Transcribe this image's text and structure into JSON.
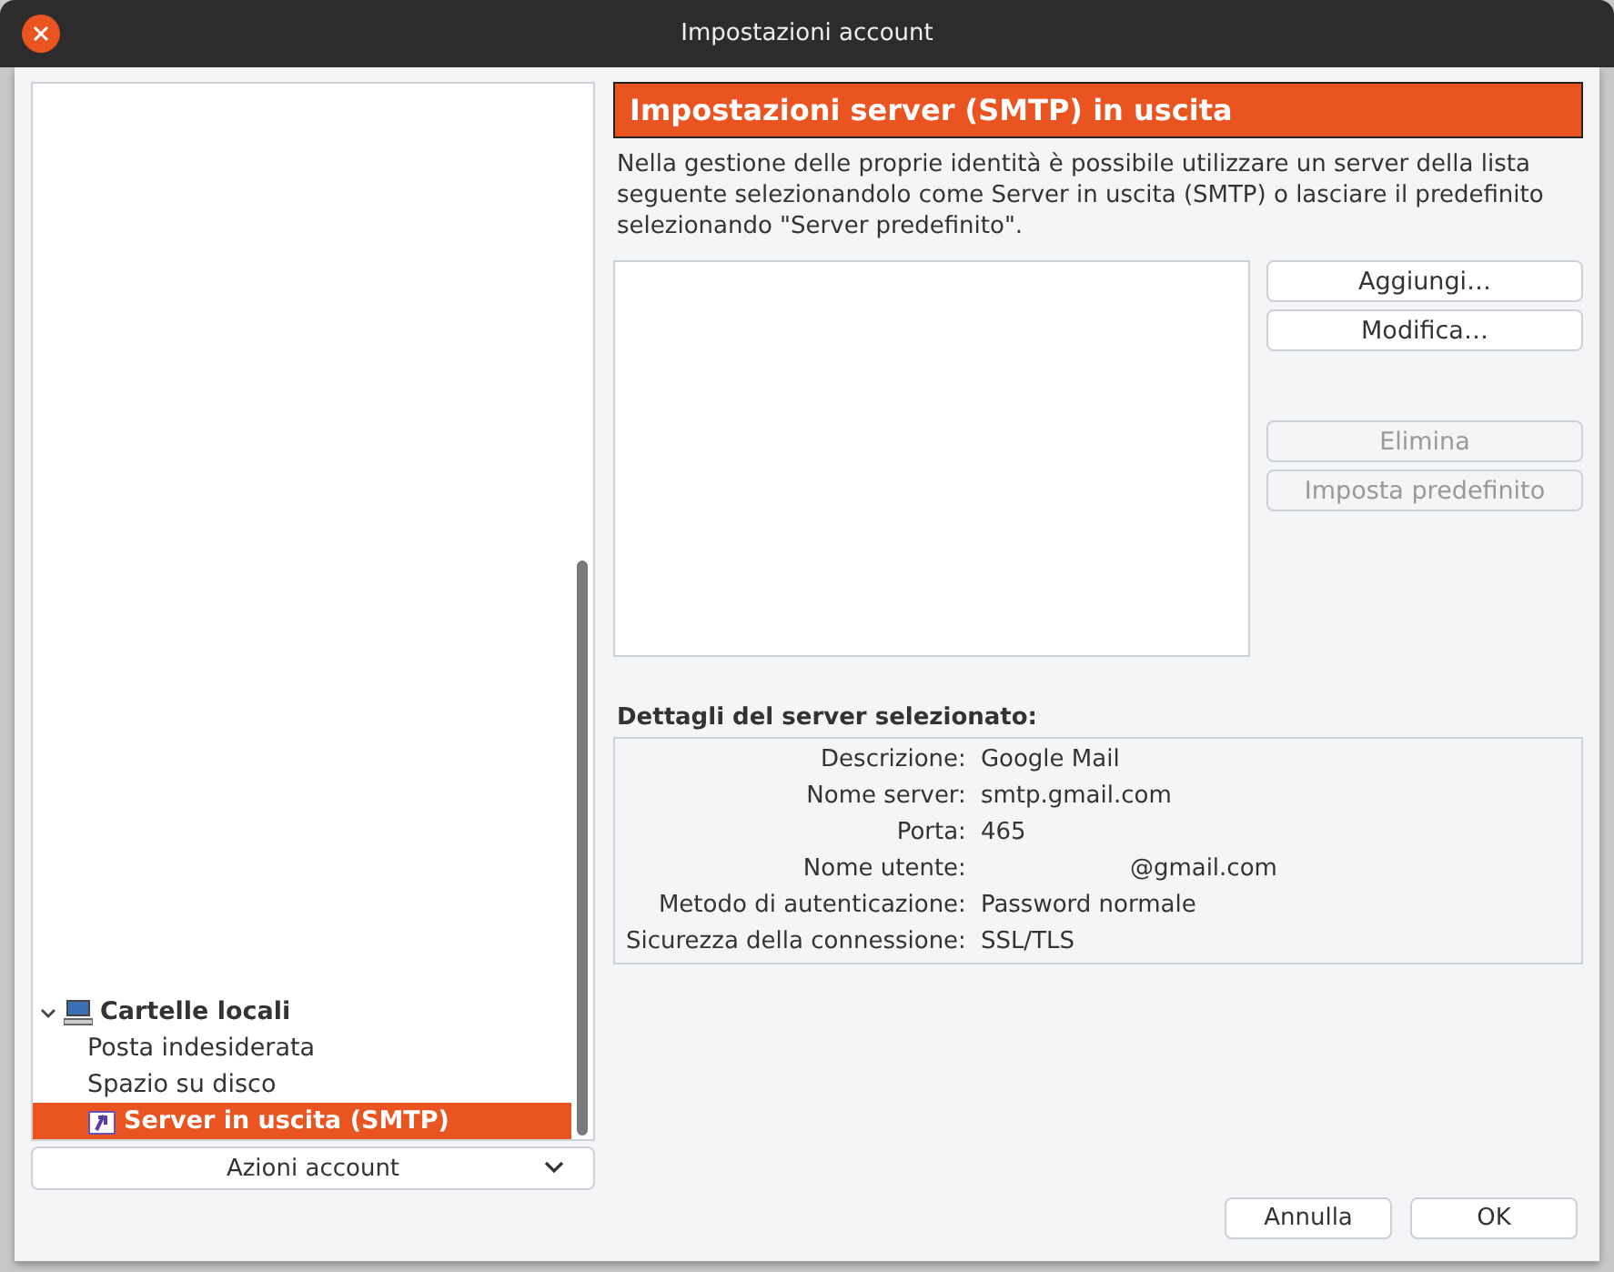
{
  "window": {
    "title": "Impostazioni account"
  },
  "tree": [
    {
      "label": "Cartelle locali",
      "expanded": true,
      "selected": false,
      "children": [
        {
          "label": "Posta indesiderata",
          "selected": false
        },
        {
          "label": "Spazio su disco",
          "selected": false
        },
        {
          "label": "Server in uscita (SMTP)",
          "selected": true
        }
      ]
    }
  ],
  "account_actions": {
    "label": "Azioni account"
  },
  "header": "Impostazioni server (SMTP) in uscita",
  "description": "Nella gestione delle proprie identità è possibile utilizzare un server della lista seguente selezionandolo come Server in uscita (SMTP) o lasciare il predefinito selezionando \"Server predefinito\".",
  "server_buttons": [
    {
      "label": "Aggiungi…",
      "disabled": false
    },
    {
      "label": "Modifica…",
      "disabled": false
    },
    {
      "label": "Elimina",
      "disabled": true
    },
    {
      "label": "Imposta predefinito",
      "disabled": true
    }
  ],
  "details": {
    "title": "Dettagli del server selezionato:",
    "rows": [
      {
        "label": "Descrizione:",
        "value": "Google Mail"
      },
      {
        "label": "Nome server:",
        "value": "smtp.gmail.com"
      },
      {
        "label": "Porta:",
        "value": "465"
      },
      {
        "label": "Nome utente:",
        "value": "@gmail.com",
        "redacted": true
      },
      {
        "label": "Metodo di autenticazione:",
        "value": "Password normale"
      },
      {
        "label": "Sicurezza della connessione:",
        "value": "SSL/TLS"
      }
    ]
  },
  "footer_buttons": [
    "Annulla",
    "OK"
  ]
}
